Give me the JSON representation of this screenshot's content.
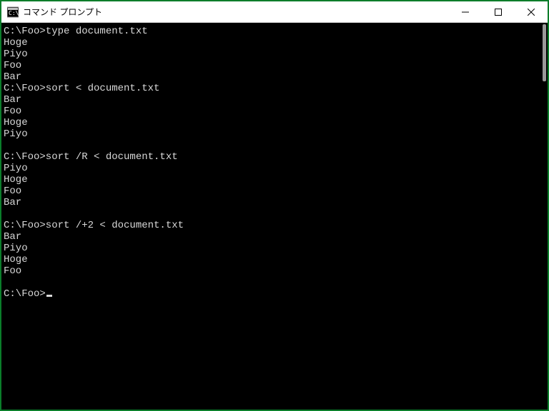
{
  "window": {
    "title": "コマンド プロンプト"
  },
  "terminal": {
    "prompt": "C:\\Foo>",
    "blocks": [
      {
        "cmd": "type document.txt",
        "out": [
          "Hoge",
          "Piyo",
          "Foo",
          "Bar"
        ],
        "trailingBlank": false
      },
      {
        "cmd": "sort < document.txt",
        "out": [
          "Bar",
          "Foo",
          "Hoge",
          "Piyo"
        ],
        "trailingBlank": true
      },
      {
        "cmd": "sort /R < document.txt",
        "out": [
          "Piyo",
          "Hoge",
          "Foo",
          "Bar"
        ],
        "trailingBlank": true
      },
      {
        "cmd": "sort /+2 < document.txt",
        "out": [
          "Bar",
          "Piyo",
          "Hoge",
          "Foo"
        ],
        "trailingBlank": true
      }
    ]
  }
}
